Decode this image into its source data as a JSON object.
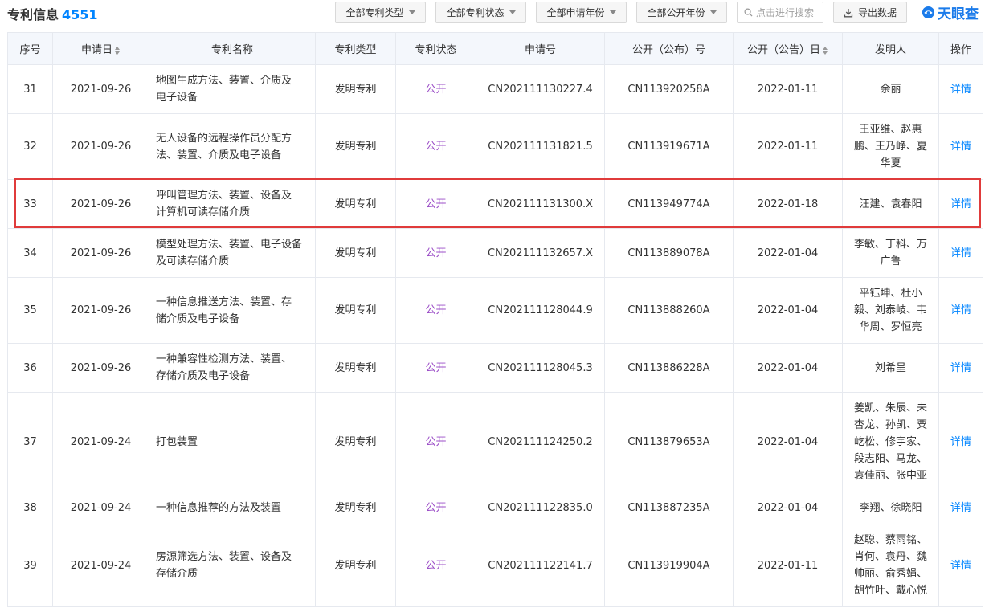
{
  "header": {
    "title": "专利信息",
    "count": "4551",
    "filters": [
      "全部专利类型",
      "全部专利状态",
      "全部申请年份",
      "全部公开年份"
    ],
    "search_placeholder": "点击进行搜索",
    "export_label": "导出数据",
    "logo_text": "天眼查"
  },
  "table": {
    "columns": [
      "序号",
      "申请日",
      "专利名称",
      "专利类型",
      "专利状态",
      "申请号",
      "公开（公布）号",
      "公开（公告）日",
      "发明人",
      "操作"
    ],
    "rows": [
      {
        "no": "31",
        "date": "2021-09-26",
        "name": [
          "地图生成方法、装置、介质及",
          "电子设备"
        ],
        "type": "发明专利",
        "status": "公开",
        "app_no": "CN202111130227.4",
        "pub_no": "CN113920258A",
        "pub_date": "2022-01-11",
        "inventors": [
          "余丽"
        ],
        "action": "详情"
      },
      {
        "no": "32",
        "date": "2021-09-26",
        "name": [
          "无人设备的远程操作员分配方",
          "法、装置、介质及电子设备"
        ],
        "type": "发明专利",
        "status": "公开",
        "app_no": "CN202111131821.5",
        "pub_no": "CN113919671A",
        "pub_date": "2022-01-11",
        "inventors": [
          "王亚维、赵惠",
          "鹏、王乃峥、夏",
          "华夏"
        ],
        "action": "详情"
      },
      {
        "no": "33",
        "date": "2021-09-26",
        "name": [
          "呼叫管理方法、装置、设备及",
          "计算机可读存储介质"
        ],
        "type": "发明专利",
        "status": "公开",
        "app_no": "CN202111131300.X",
        "pub_no": "CN113949774A",
        "pub_date": "2022-01-18",
        "inventors": [
          "汪建、袁春阳"
        ],
        "action": "详情"
      },
      {
        "no": "34",
        "date": "2021-09-26",
        "name": [
          "模型处理方法、装置、电子设备",
          "及可读存储介质"
        ],
        "type": "发明专利",
        "status": "公开",
        "app_no": "CN202111132657.X",
        "pub_no": "CN113889078A",
        "pub_date": "2022-01-04",
        "inventors": [
          "李敏、丁科、万",
          "广鲁"
        ],
        "action": "详情"
      },
      {
        "no": "35",
        "date": "2021-09-26",
        "name": [
          "一种信息推送方法、装置、存",
          "储介质及电子设备"
        ],
        "type": "发明专利",
        "status": "公开",
        "app_no": "CN202111128044.9",
        "pub_no": "CN113888260A",
        "pub_date": "2022-01-04",
        "inventors": [
          "平钰坤、杜小",
          "毅、刘泰岐、韦",
          "华周、罗恒亮"
        ],
        "action": "详情"
      },
      {
        "no": "36",
        "date": "2021-09-26",
        "name": [
          "一种兼容性检测方法、装置、",
          "存储介质及电子设备"
        ],
        "type": "发明专利",
        "status": "公开",
        "app_no": "CN202111128045.3",
        "pub_no": "CN113886228A",
        "pub_date": "2022-01-04",
        "inventors": [
          "刘希呈"
        ],
        "action": "详情"
      },
      {
        "no": "37",
        "date": "2021-09-24",
        "name": [
          "打包装置"
        ],
        "type": "发明专利",
        "status": "公开",
        "app_no": "CN202111124250.2",
        "pub_no": "CN113879653A",
        "pub_date": "2022-01-04",
        "inventors": [
          "姜凯、朱辰、未",
          "杏龙、孙凯、粟",
          "屹松、修宇家、",
          "段志阳、马龙、",
          "袁佳丽、张中亚"
        ],
        "action": "详情"
      },
      {
        "no": "38",
        "date": "2021-09-24",
        "name": [
          "一种信息推荐的方法及装置"
        ],
        "type": "发明专利",
        "status": "公开",
        "app_no": "CN202111122835.0",
        "pub_no": "CN113887235A",
        "pub_date": "2022-01-04",
        "inventors": [
          "李翔、徐晓阳"
        ],
        "action": "详情"
      },
      {
        "no": "39",
        "date": "2021-09-24",
        "name": [
          "房源筛选方法、装置、设备及",
          "存储介质"
        ],
        "type": "发明专利",
        "status": "公开",
        "app_no": "CN202111122141.7",
        "pub_no": "CN113919904A",
        "pub_date": "2022-01-11",
        "inventors": [
          "赵聪、蔡雨铭、",
          "肖何、袁丹、魏",
          "帅丽、俞秀娟、",
          "胡竹叶、戴心悦"
        ],
        "action": "详情"
      }
    ]
  },
  "colors": {
    "accent": "#0084ff",
    "status": "#9b4dc7",
    "highlight": "#e03b3b",
    "header_bg": "#f4f7fc"
  }
}
